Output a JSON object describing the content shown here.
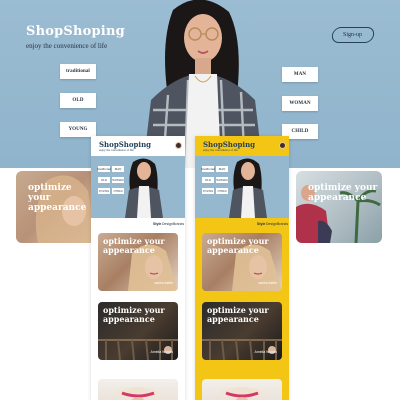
{
  "hero": {
    "brand": "ShopShoping",
    "tagline": "enjoy the convenience of life",
    "signup": "Sign-up",
    "left_chips": [
      "traditional",
      "OLD",
      "YOUNG"
    ],
    "right_chips": [
      "MAN",
      "WOMAN",
      "CHILD"
    ]
  },
  "bg_cards": {
    "left_title": "optimize your appearance",
    "right_title": "optimize your appearance"
  },
  "phone": {
    "brand": "ShopShoping",
    "tagline": "enjoy the convenience of life",
    "tabs": [
      "Style",
      "Design",
      "Brands"
    ],
    "cards": [
      {
        "title": "optimize your appearance",
        "name": "sasha kaller"
      },
      {
        "title": "optimize your appearance",
        "name": "Amelia Woods"
      }
    ]
  },
  "colors": {
    "hero_blue": "#96b8cf",
    "accent_yellow": "#f3c514",
    "navy": "#26415a"
  }
}
